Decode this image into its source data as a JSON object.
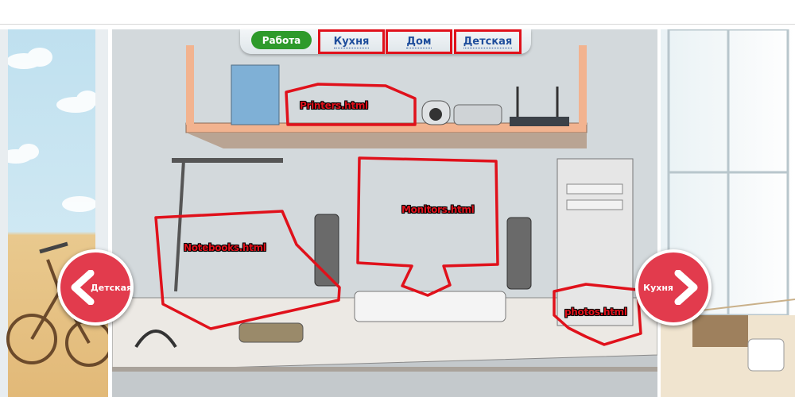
{
  "tabs": {
    "work": "Работа",
    "kitchen": "Кухня",
    "home": "Дом",
    "kids": "Детская"
  },
  "hotspots": {
    "printers": "Printers.html",
    "monitors": "Monitors.html",
    "notebooks": "Notebooks.html",
    "photos": "photos.html"
  },
  "nav": {
    "prev_label": "Детская",
    "next_label": "Кухня"
  },
  "colors": {
    "accent_red": "#e0111b",
    "nav_red": "#e23b4d",
    "active_tab_green": "#2e9a2b",
    "link_blue": "#1f4e9c"
  }
}
